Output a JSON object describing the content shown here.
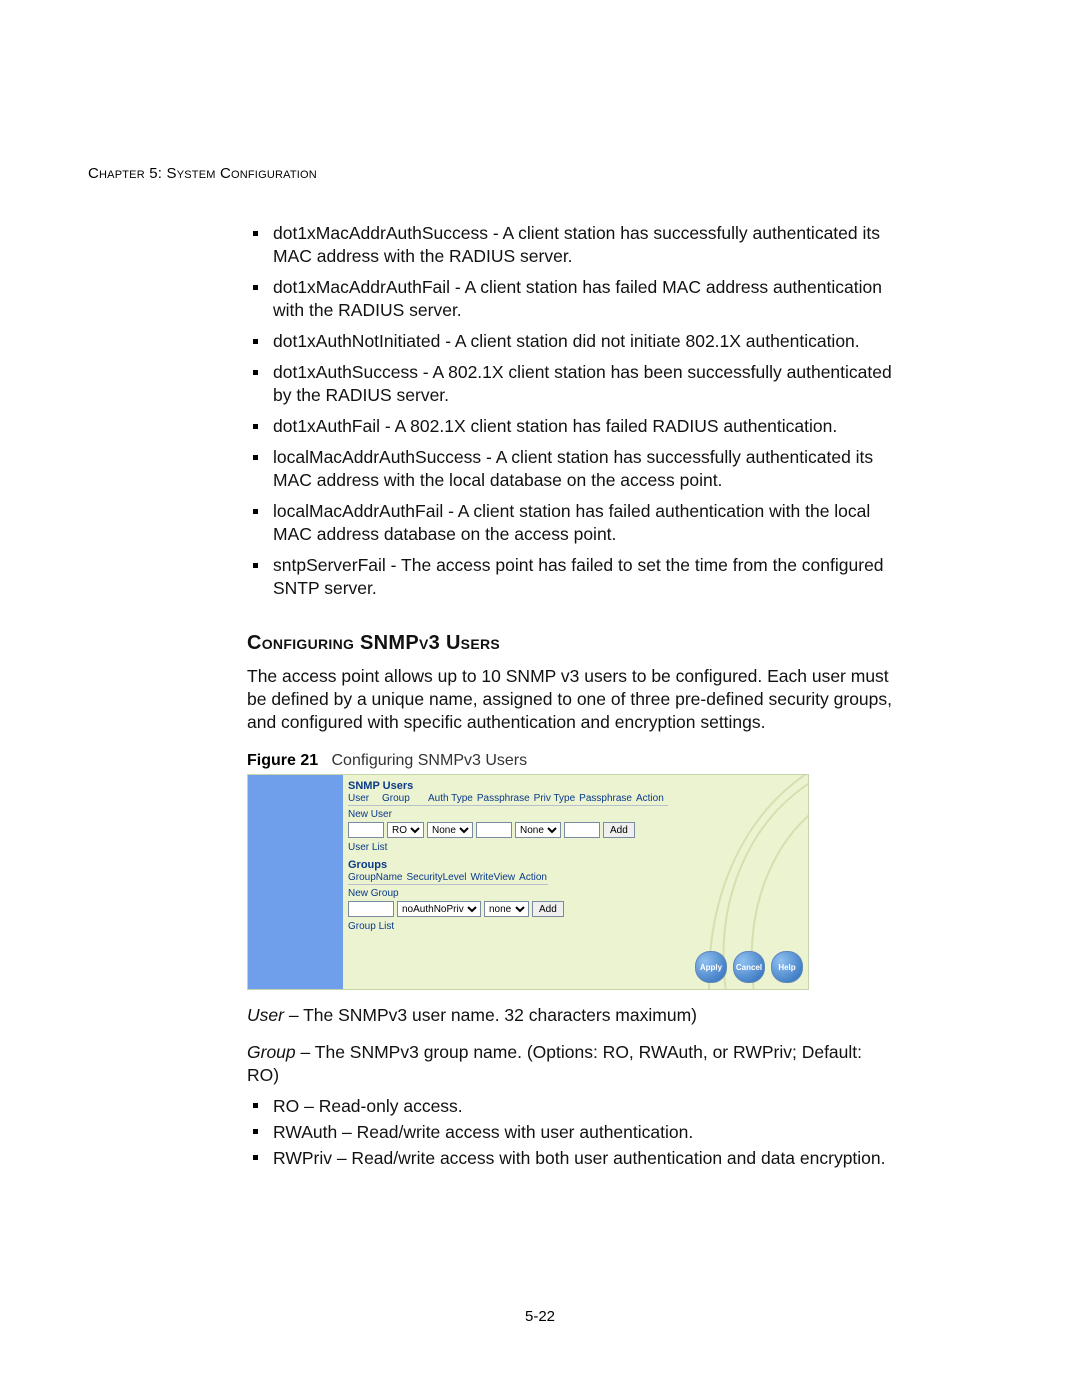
{
  "chapter_head": "Chapter 5: System Configuration",
  "bullets": [
    "dot1xMacAddrAuthSuccess - A client station has successfully authenticated its MAC address with the RADIUS server.",
    "dot1xMacAddrAuthFail - A client station has failed MAC address authentication with the RADIUS server.",
    "dot1xAuthNotInitiated - A client station did not initiate 802.1X authentication.",
    "dot1xAuthSuccess - A 802.1X client station has been successfully authenticated by the RADIUS server.",
    "dot1xAuthFail - A 802.1X client station has failed RADIUS authentication.",
    "localMacAddrAuthSuccess - A client station has successfully authenticated its MAC address with the local database on the access point.",
    "localMacAddrAuthFail - A client station has failed authentication with the local MAC address database on the access point.",
    "sntpServerFail - The access point has failed to set the time from the configured SNTP server."
  ],
  "section": {
    "heading": "Configuring SNMPv3 Users",
    "para": "The access point allows up to 10 SNMP v3 users to be configured. Each user must be defined by a unique name, assigned to one of three pre-defined security groups, and configured with specific authentication and encryption settings."
  },
  "figure": {
    "caption_bold": "Figure 21",
    "caption_text": "Configuring SNMPv3 Users",
    "snmp_users_title": "SNMP Users",
    "users_header": [
      "User",
      "Group",
      "Auth Type",
      "Passphrase",
      "Priv Type",
      "Passphrase",
      "Action"
    ],
    "new_user_label": "New User",
    "group_select": "RO",
    "authtype_select": "None",
    "privtype_select": "None",
    "add_btn": "Add",
    "user_list_label": "User List",
    "groups_title": "Groups",
    "groups_header": [
      "GroupName",
      "SecurityLevel",
      "WriteView",
      "Action"
    ],
    "new_group_label": "New Group",
    "seclevel_select": "noAuthNoPriv",
    "writeview_select": "none",
    "group_list_label": "Group List",
    "buttons": {
      "apply": "Apply",
      "cancel": "Cancel",
      "help": "Help"
    }
  },
  "field_user_label": "User",
  "field_user_desc": " – The SNMPv3 user name. 32 characters maximum)",
  "field_group_label": "Group",
  "field_group_desc": " – The SNMPv3 group name. (Options: RO, RWAuth, or RWPriv; Default: RO)",
  "group_options": [
    "RO – Read-only access.",
    "RWAuth – Read/write access with user authentication.",
    "RWPriv – Read/write access with both user authentication and data encryption."
  ],
  "page_num": "5-22"
}
